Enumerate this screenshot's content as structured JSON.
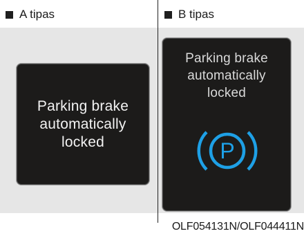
{
  "panel_a": {
    "heading": "A tipas",
    "message_lines": [
      "Parking brake",
      "automatically",
      "locked"
    ]
  },
  "panel_b": {
    "heading": "B tipas",
    "message_lines": [
      "Parking brake",
      "automatically",
      "locked"
    ],
    "icon": "parking-brake-icon",
    "icon_letter": "P",
    "icon_color": "#1ea0e6"
  },
  "image_code": "OLF054131N/OLF044411N",
  "colors": {
    "screen_bg": "#1c1b1a",
    "screen_text": "#f2f2f2",
    "background_band": "#e6e6e6"
  }
}
